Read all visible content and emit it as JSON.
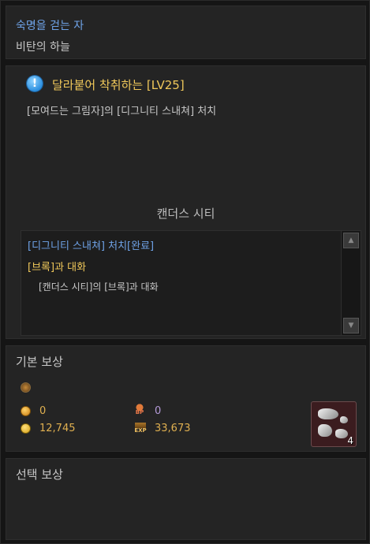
{
  "header": {
    "title": "숙명을 걷는 자",
    "subtitle": "비탄의 하늘"
  },
  "objective": {
    "icon": "exclamation-icon",
    "title": "달라붙어 착취하는 [LV25]",
    "description": "[모여드는 그림자]의 [디그니티 스내쳐] 처치"
  },
  "location": "캔더스 시티",
  "steps": {
    "completed": "[디그니티 스내쳐] 처치[완료]",
    "current": "[브록]과 대화",
    "detail": "[캔더스 시티]의 [브록]과 대화"
  },
  "rewards": {
    "basic_title": "기본 보상",
    "gold": "0",
    "bp": "0",
    "coin": "12,745",
    "exp": "33,673",
    "item": {
      "icon": "silver-ore-icon",
      "count": "4"
    },
    "choice_title": "선택 보상"
  },
  "colors": {
    "blue_text": "#6fa3e8",
    "gold_text": "#f0c85a",
    "panel_bg": "#242424"
  }
}
